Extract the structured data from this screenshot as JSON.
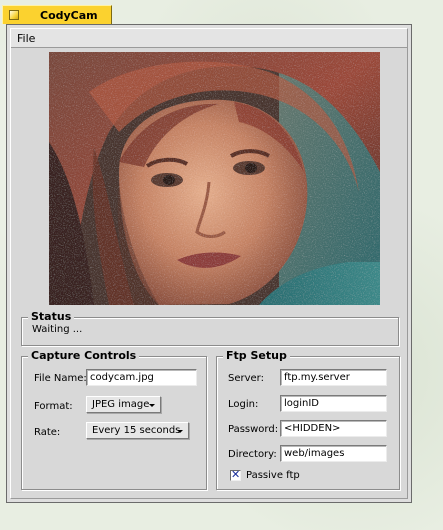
{
  "window": {
    "title": "CodyCam"
  },
  "menubar": {
    "file": "File"
  },
  "status": {
    "title": "Status",
    "text": "Waiting ..."
  },
  "capture_controls": {
    "title": "Capture Controls",
    "file_name_label": "File Name:",
    "file_name_value": "codycam.jpg",
    "format_label": "Format:",
    "format_value": "JPEG image",
    "rate_label": "Rate:",
    "rate_value": "Every 15 seconds"
  },
  "ftp_setup": {
    "title": "Ftp Setup",
    "server_label": "Server:",
    "server_value": "ftp.my.server",
    "login_label": "Login:",
    "login_value": "loginID",
    "password_label": "Password:",
    "password_value": "<HIDDEN>",
    "directory_label": "Directory:",
    "directory_value": "web/images",
    "passive_label": "Passive ftp",
    "passive_checked": true
  },
  "icons": {
    "close": "close-icon",
    "menu_arrow": "chevron-down-icon",
    "check": "checkmark-icon"
  },
  "colors": {
    "title_tab": "#fbd22f",
    "window_bg": "#d8d8d8",
    "check_mark": "#1a2f9a"
  }
}
